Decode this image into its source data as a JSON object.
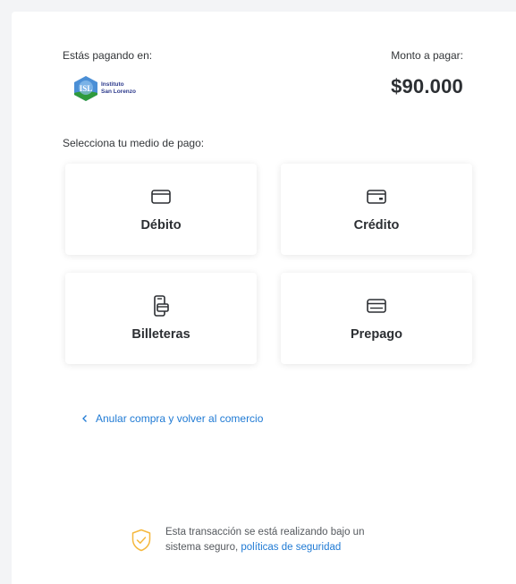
{
  "merchant": {
    "label": "Estás pagando en:",
    "logo_line1": "Instituto",
    "logo_line2": "San Lorenzo",
    "logo_mark": "ISL"
  },
  "amount": {
    "label": "Monto a pagar:",
    "value": "$90.000"
  },
  "payment": {
    "prompt": "Selecciona tu medio de pago:",
    "methods": [
      {
        "label": "Débito",
        "icon": "debit-card-icon"
      },
      {
        "label": "Crédito",
        "icon": "credit-card-icon"
      },
      {
        "label": "Billeteras",
        "icon": "wallet-icon"
      },
      {
        "label": "Prepago",
        "icon": "prepaid-card-icon"
      }
    ]
  },
  "cancel": {
    "label": "Anular compra y volver al comercio"
  },
  "security": {
    "text": "Esta transacción se está realizando bajo un sistema seguro, ",
    "link": "políticas de seguridad",
    "icon": "shield-check-icon"
  },
  "colors": {
    "link": "#1f7ad4",
    "shield": "#f5b83d",
    "text": "#2c2f33"
  }
}
